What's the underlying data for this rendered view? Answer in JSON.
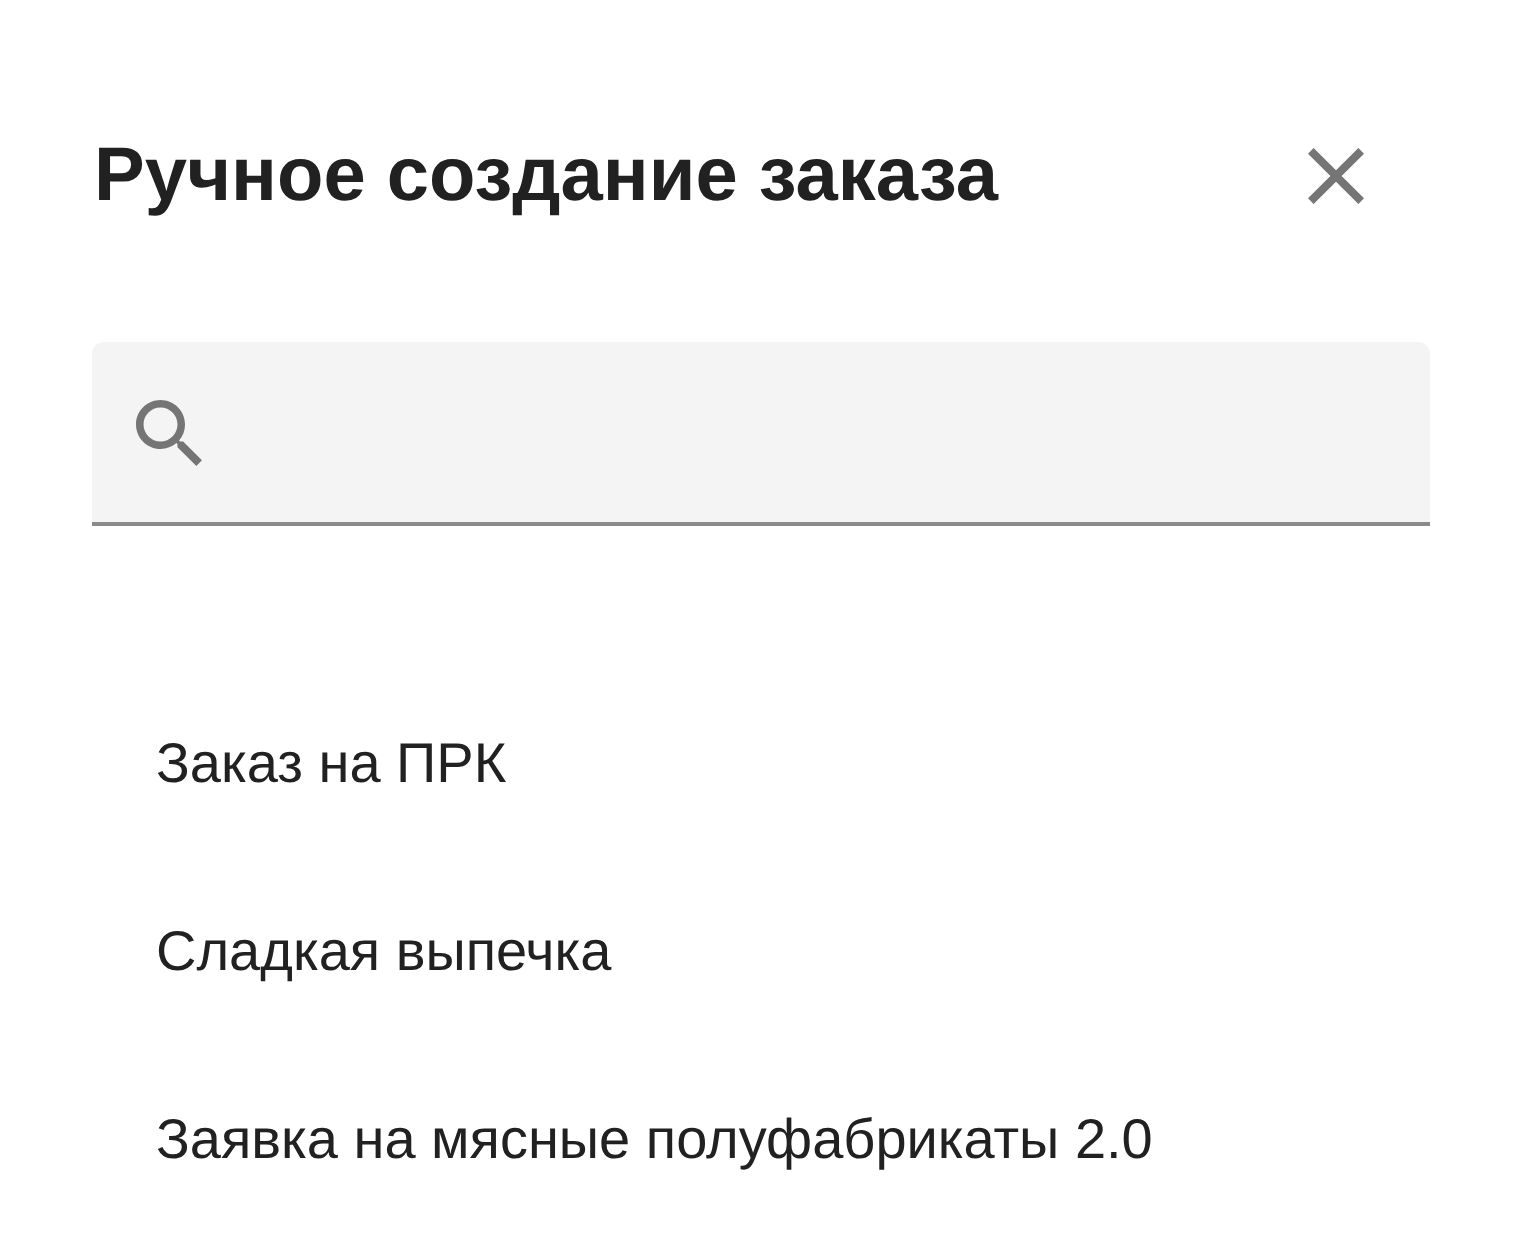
{
  "dialog": {
    "title": "Ручное создание заказа"
  },
  "options": [
    {
      "label": "Заказ на ПРК"
    },
    {
      "label": "Сладкая выпечка"
    },
    {
      "label": "Заявка на мясные полуфабрикаты 2.0"
    }
  ]
}
